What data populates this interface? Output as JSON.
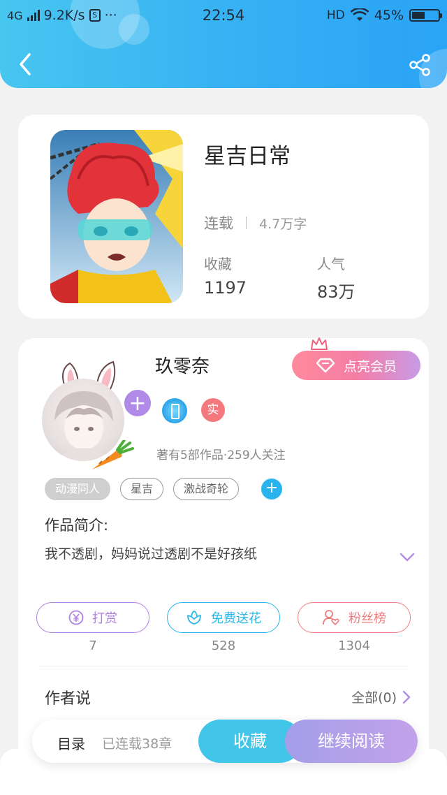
{
  "status_bar": {
    "network": "4G",
    "speed": "9.2K/s",
    "more": "···",
    "time": "22:54",
    "hd": "HD",
    "battery_text": "45%",
    "battery_level": 0.45
  },
  "header": {
    "back_icon": "chevron-left-icon",
    "share_icon": "share-icon",
    "background_color": "#36b0f3"
  },
  "book": {
    "title": "星吉日常",
    "status": "连载",
    "word_count": "4.7万字",
    "collect_label": "收藏",
    "collect_value": "1197",
    "popularity_label": "人气",
    "popularity_value": "83万"
  },
  "author": {
    "name": "玖零奈",
    "vip_button": "点亮会员",
    "badge_real": "实",
    "meta": "著有5部作品·259人关注",
    "tags": [
      "动漫同人",
      "星吉",
      "激战奇轮"
    ],
    "intro_title": "作品简介:",
    "intro_text": "我不透剧，妈妈说过透剧不是好孩纸"
  },
  "actions": [
    {
      "label": "打赏",
      "count": "7",
      "color": "#b07fe0"
    },
    {
      "label": "免费送花",
      "count": "528",
      "color": "#2ab8e8"
    },
    {
      "label": "粉丝榜",
      "count": "1304",
      "color": "#ef7d7d"
    }
  ],
  "author_says": {
    "title": "作者说",
    "see_all": "全部(0)"
  },
  "bottom_bar": {
    "toc": "目录",
    "chapters": "已连载38章",
    "collect": "收藏",
    "continue": "继续阅读"
  }
}
